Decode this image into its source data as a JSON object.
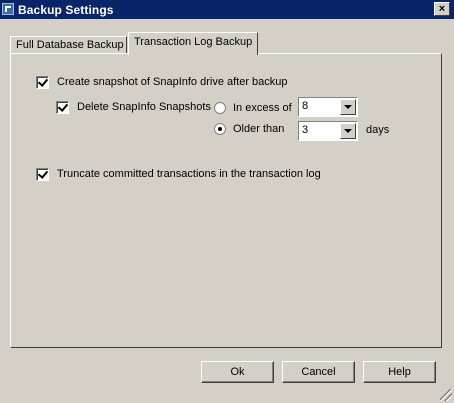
{
  "window": {
    "title": "Backup Settings",
    "close_label": "×",
    "icons": {
      "app": "app-icon",
      "close": "close-icon"
    }
  },
  "tabs": [
    {
      "label": "Full Database Backup",
      "selected": false
    },
    {
      "label": "Transaction Log Backup",
      "selected": true
    }
  ],
  "options": {
    "create_snapshot": {
      "label": "Create snapshot of SnapInfo drive after backup",
      "checked": true
    },
    "delete_snapshots": {
      "label": "Delete SnapInfo Snapshots",
      "checked": true
    },
    "in_excess_of": {
      "label": "In excess of",
      "selected": false,
      "value": "8"
    },
    "older_than": {
      "label": "Older than",
      "selected": true,
      "value": "3",
      "unit": "days"
    },
    "truncate": {
      "label": "Truncate committed transactions in the transaction log",
      "checked": true
    }
  },
  "buttons": {
    "ok": "Ok",
    "cancel": "Cancel",
    "help": "Help"
  },
  "colors": {
    "titlebar": "#0a246a",
    "face": "#d4d0c8"
  }
}
